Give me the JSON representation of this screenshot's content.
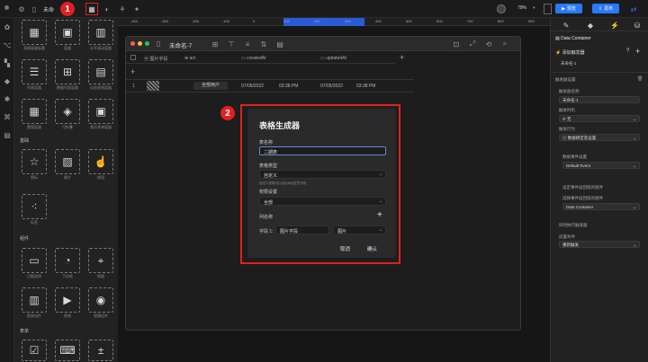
{
  "topbar": {
    "tab_title": "未命",
    "zoom": "79%",
    "preview_label": "预览",
    "publish_label": "发布"
  },
  "badges": {
    "one": "1",
    "two": "2"
  },
  "ruler": {
    "ticks": [
      "-450",
      "-300",
      "-200",
      "-100",
      "0",
      "100",
      "200",
      "300",
      "400",
      "500",
      "600",
      "700",
      "800",
      "900"
    ]
  },
  "left_panel": {
    "tiles_row1": [
      "表格容器标题",
      "容器",
      "水平滚动容器"
    ],
    "tiles_row2": [
      "列表容器",
      "数据列表容器",
      "动态表格容器"
    ],
    "tiles_row3": [
      "蒙版容器",
      "可折叠",
      "悬浮表单容器"
    ],
    "section_basic": "基础",
    "basic_row1": [
      "图标",
      "图片",
      "按钮"
    ],
    "basic_row2": [
      "标签"
    ],
    "section_components": "组件",
    "comp_row1": [
      "日期选择",
      "下拉框",
      "地图"
    ],
    "comp_row2": [
      "图表组件",
      "视频",
      "直播组件"
    ],
    "section_form": "表单"
  },
  "app_window": {
    "title": "未命名-7",
    "columns": [
      "图片字段",
      "act",
      "createdAt",
      "updatedAt"
    ],
    "add_col": "+",
    "add_row": "+",
    "row": {
      "index": "1",
      "tag": "全部用户",
      "created_date": "07/05/2022",
      "created_time": "03:38 PM",
      "updated_date": "07/05/2022",
      "updated_time": "03:38 PM"
    }
  },
  "dialog": {
    "title": "表格生成器",
    "name_label": "表名称",
    "name_value": "二期表",
    "type_label": "表格类型",
    "type_value": "自定义",
    "type_hint": "自定义表格可以自由添加任意字段",
    "perm_label": "权限设置",
    "perm_value": "全部",
    "cols_label": "列名称",
    "add_icon": "+",
    "field_label": "字段 1:",
    "field_value": "图片字段",
    "field_type": "图片",
    "cancel": "取消",
    "confirm": "确认"
  },
  "right_panel": {
    "container_title": "Data Container",
    "add_label": "添加触发器",
    "name_value": "未命名-1",
    "trigger_settings": "触发器设置",
    "trigger_name_label": "触发器名称",
    "trigger_name_value": "未命名-1",
    "trigger_time_label": "触发时机",
    "trigger_time_value": "无",
    "trigger_action_label": "触发行为",
    "trigger_action_value": "数据绑定及设置",
    "data_event_label": "数据事件设置",
    "data_event_value": "Default Event",
    "return_label": "设定事件返回值的组件",
    "select_label": "选择事件返回值的组件",
    "select_value": "Data Container",
    "sync_label": "同时执行触发器",
    "condition_label": "前置条件",
    "condition_value": "重新触发"
  }
}
